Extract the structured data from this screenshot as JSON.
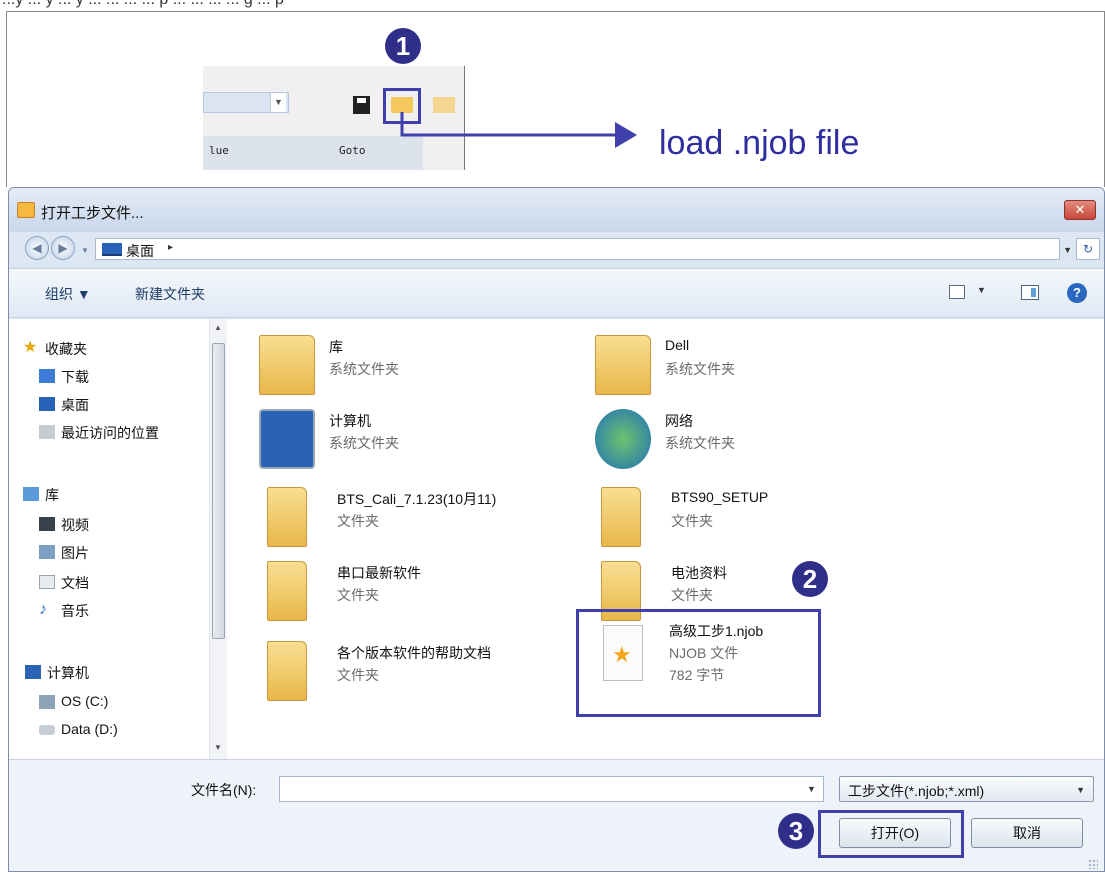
{
  "caption": "...y ... y ... y ... ... ... ... p ... ... ... ... g ... p",
  "top_panel": {
    "columns": [
      "lue",
      "Goto"
    ],
    "badge_1": "1",
    "load_label": "load .njob file"
  },
  "dialog": {
    "title": "打开工步文件...",
    "close_label": "✕",
    "address": {
      "crumb": "桌面",
      "crumb_arrow": "▸"
    },
    "toolbar": {
      "organize": "组织 ▼",
      "new_folder": "新建文件夹",
      "help": "?"
    },
    "nav": {
      "favorites": "收藏夹",
      "downloads": "下载",
      "desktop": "桌面",
      "recent": "最近访问的位置",
      "libraries": "库",
      "videos": "视频",
      "pictures": "图片",
      "documents": "文档",
      "music": "音乐",
      "computer": "计算机",
      "drive_c": "OS (C:)",
      "drive_d": "Data (D:)"
    },
    "items": [
      {
        "name": "库",
        "sub": "系统文件夹"
      },
      {
        "name": "Dell",
        "sub": "系统文件夹"
      },
      {
        "name": "计算机",
        "sub": "系统文件夹"
      },
      {
        "name": "网络",
        "sub": "系统文件夹"
      },
      {
        "name": "BTS_Cali_7.1.23(10月11)",
        "sub": "文件夹"
      },
      {
        "name": "BTS90_SETUP",
        "sub": "文件夹"
      },
      {
        "name": "串口最新软件",
        "sub": "文件夹"
      },
      {
        "name": "电池资料",
        "sub": "文件夹"
      },
      {
        "name": "各个版本软件的帮助文档",
        "sub": "文件夹"
      },
      {
        "name": "高级工步1.njob",
        "sub": "NJOB 文件",
        "size": "782 字节"
      }
    ],
    "badge_2": "2",
    "badge_3": "3",
    "footer": {
      "filename_label": "文件名(N):",
      "filename_value": "",
      "filter": "工步文件(*.njob;*.xml)",
      "open": "打开(O)",
      "cancel": "取消"
    }
  },
  "colors": {
    "accent": "#3f3fae",
    "folder": "#e8b74a",
    "title_bar": "#c9d7ea"
  }
}
